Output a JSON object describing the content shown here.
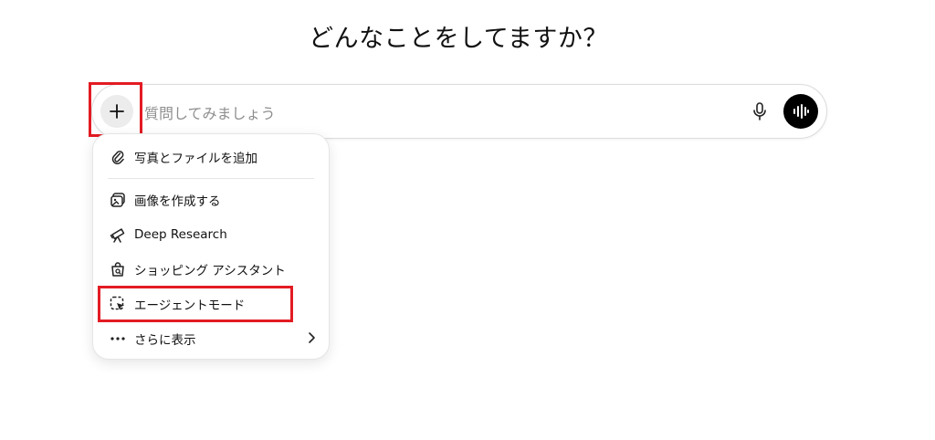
{
  "heading": "どんなことをしてますか？",
  "composer": {
    "placeholder": "質問してみましょう",
    "plus_icon": "plus-icon",
    "mic_icon": "microphone-icon",
    "voice_icon": "voice-waveform-icon"
  },
  "menu": {
    "items": [
      {
        "label": "写真とファイルを追加",
        "icon": "paperclip-icon"
      },
      {
        "label": "画像を作成する",
        "icon": "image-create-icon"
      },
      {
        "label": "Deep Research",
        "icon": "telescope-icon"
      },
      {
        "label": "ショッピング アシスタント",
        "icon": "shopping-bag-icon"
      },
      {
        "label": "エージェントモード",
        "icon": "agent-cursor-icon"
      },
      {
        "label": "さらに表示",
        "icon": "ellipsis-icon"
      }
    ]
  },
  "colors": {
    "highlight": "#e31b23",
    "voice_button": "#000000",
    "plus_button_bg": "#ececec"
  }
}
